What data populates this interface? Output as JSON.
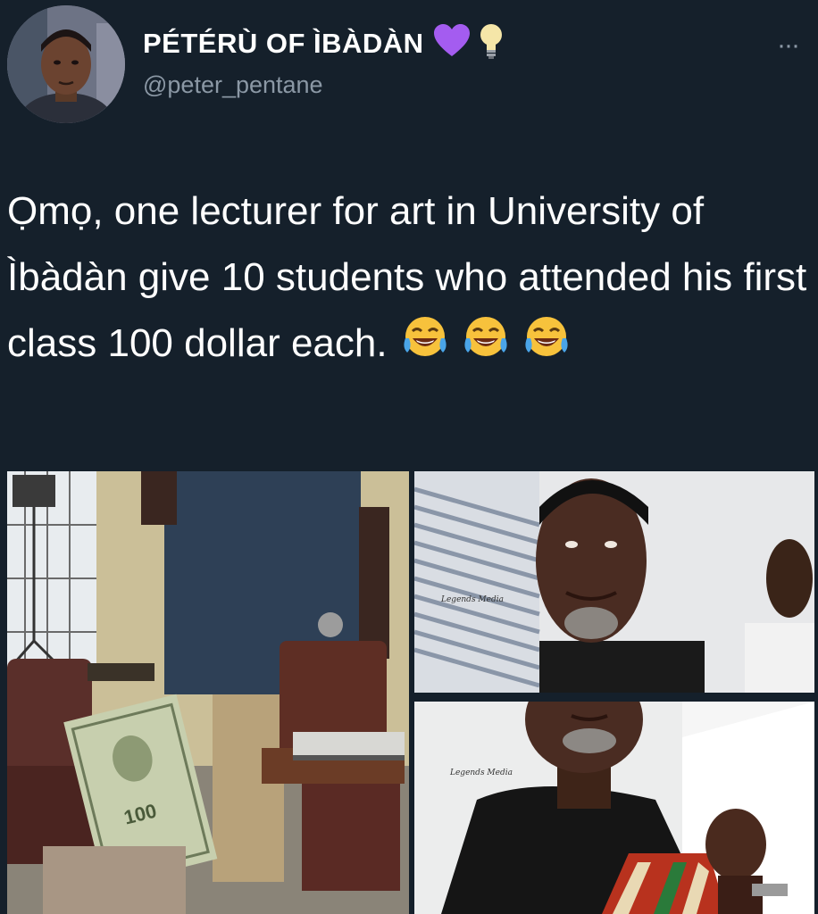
{
  "author": {
    "display_name": "PÉTÉRÙ OF ÌBÀDÀN",
    "handle": "@peter_pentane",
    "badges": [
      "purple-heart-icon",
      "lightbulb-icon"
    ]
  },
  "tweet": {
    "text": "Ọmọ,  one lecturer for art in University of Ìbàdàn give 10 students who attended his first class 100 dollar each.",
    "emojis": [
      "face-with-tears-of-joy-icon",
      "face-with-tears-of-joy-icon",
      "face-with-tears-of-joy-icon"
    ]
  },
  "media": {
    "images": [
      {
        "name": "lecturer-in-classroom-photo",
        "watermark": ""
      },
      {
        "name": "lecturer-portrait-photo",
        "watermark": "Legends Media"
      },
      {
        "name": "lecturer-speaking-photo",
        "watermark": "Legends Media"
      }
    ]
  },
  "menu": {
    "label": "···"
  },
  "colors": {
    "background": "#15202b",
    "text": "#ffffff",
    "secondary": "#8b98a5"
  }
}
